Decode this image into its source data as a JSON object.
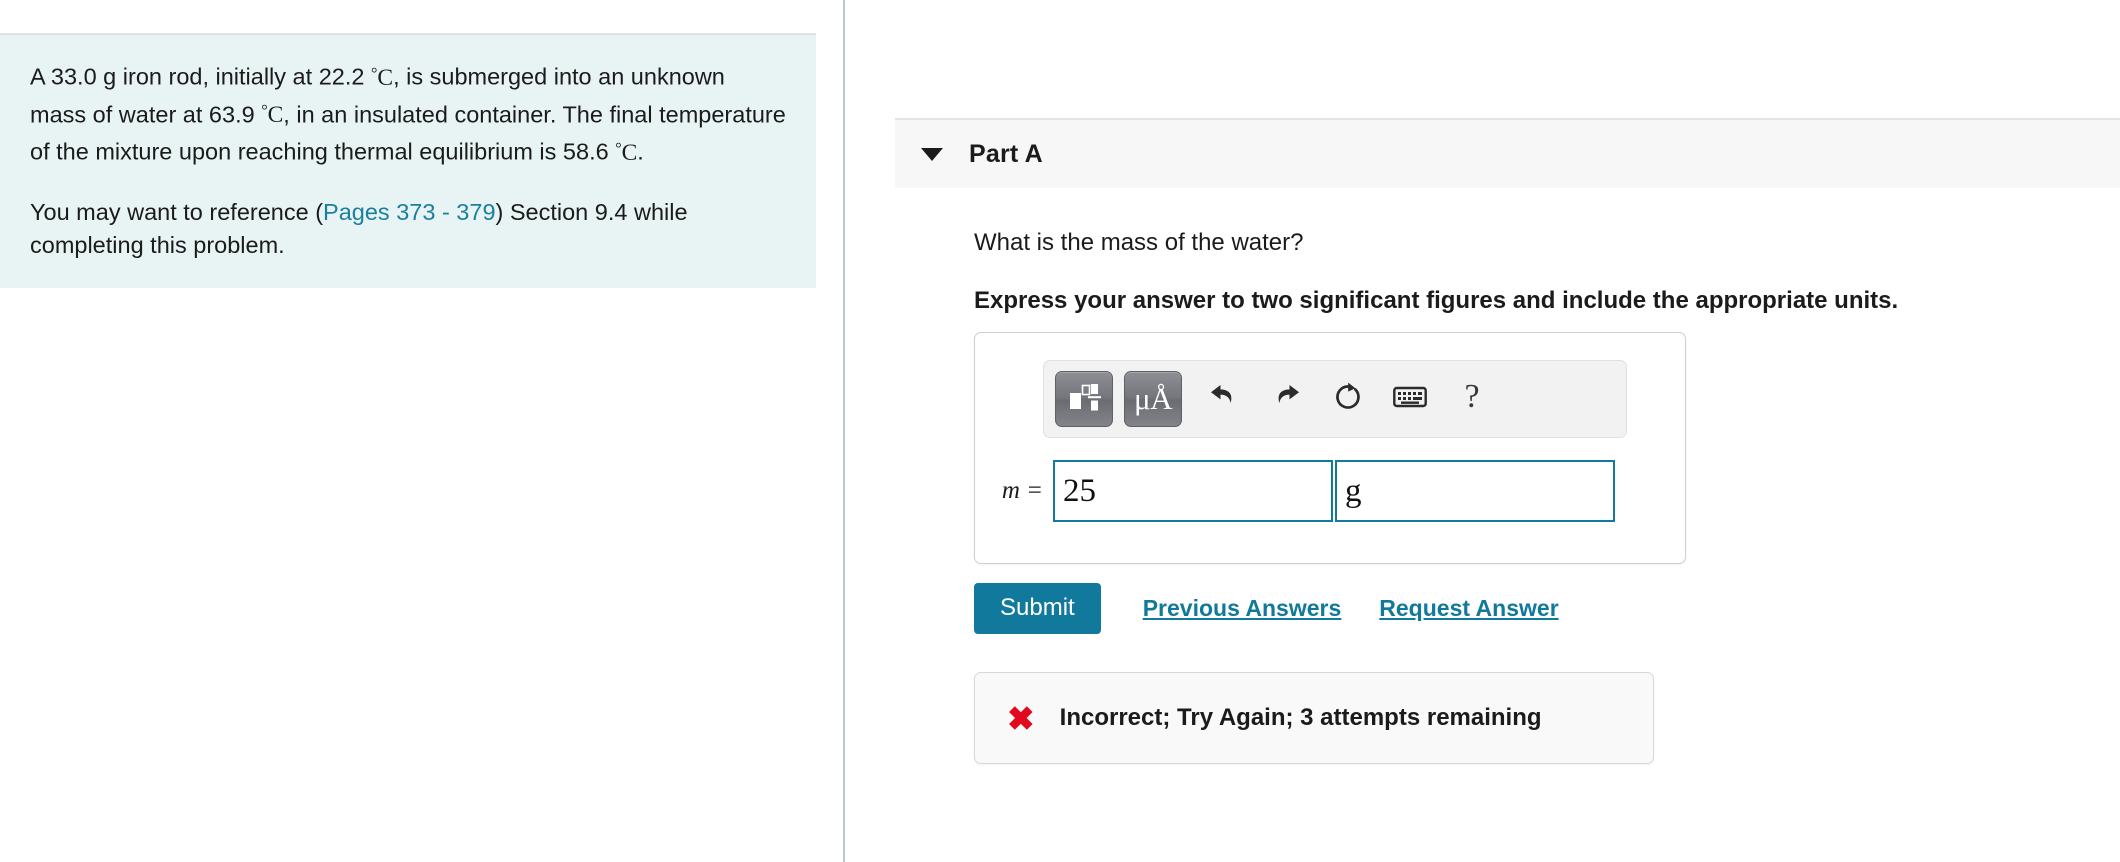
{
  "problem": {
    "statement_parts": [
      "A 33.0 g iron rod, initially at 22.2 ",
      ", is submerged into an unknown mass of water at 63.9 ",
      ", in an insulated container. The final temperature of the mixture upon reaching thermal equilibrium is 58.6 ",
      "."
    ],
    "degree_symbol": "°",
    "degree_unit": "C",
    "reference_prefix": "You may want to reference (",
    "reference_link": "Pages 373 - 379",
    "reference_suffix": ") Section 9.4 while completing this problem."
  },
  "part": {
    "label": "Part A",
    "caret_icon": "chevron-down-icon",
    "question": "What is the mass of the water?",
    "instruction": "Express your answer to two significant figures and include the appropriate units."
  },
  "answer": {
    "variable_label": "m =",
    "value": "25",
    "units": "g",
    "value_placeholder": "",
    "units_placeholder": "",
    "toolbar": [
      {
        "name": "math-template-button",
        "icon": "math-template-icon",
        "label": ""
      },
      {
        "name": "units-button",
        "icon": "micro-angstrom-icon",
        "label": "μÅ"
      },
      {
        "name": "undo-button",
        "icon": "undo-icon",
        "label": ""
      },
      {
        "name": "redo-button",
        "icon": "redo-icon",
        "label": ""
      },
      {
        "name": "reset-button",
        "icon": "reset-icon",
        "label": ""
      },
      {
        "name": "keyboard-button",
        "icon": "keyboard-icon",
        "label": ""
      },
      {
        "name": "help-button",
        "icon": "question-mark-icon",
        "label": "?"
      }
    ]
  },
  "actions": {
    "submit_label": "Submit",
    "previous_answers_label": "Previous Answers",
    "request_answer_label": "Request Answer"
  },
  "feedback": {
    "icon": "red-x-icon",
    "cross_glyph": "✖",
    "message": "Incorrect; Try Again; 3 attempts remaining"
  },
  "colors": {
    "panel_background": "#e7f4f3",
    "accent_teal": "#11799c",
    "link_teal": "#1a7fa0",
    "error_red": "#e2091f",
    "header_background": "#f7f7f7",
    "divider": "#b9c7d6"
  }
}
